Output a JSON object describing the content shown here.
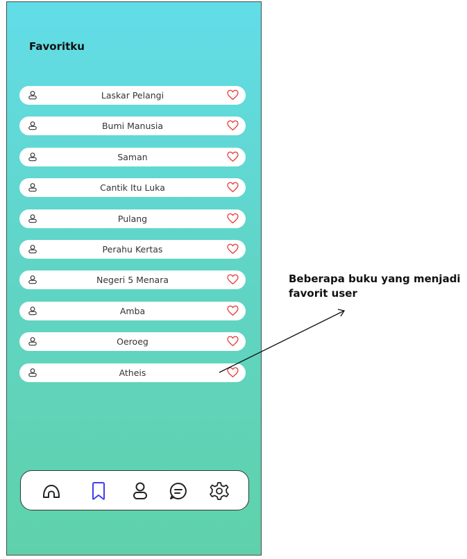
{
  "page": {
    "title": "Favoritku"
  },
  "favorites": [
    {
      "title": "Laskar Pelangi"
    },
    {
      "title": "Bumi Manusia"
    },
    {
      "title": "Saman"
    },
    {
      "title": "Cantik Itu Luka"
    },
    {
      "title": "Pulang"
    },
    {
      "title": "Perahu Kertas"
    },
    {
      "title": "Negeri 5 Menara"
    },
    {
      "title": "Amba"
    },
    {
      "title": "Oeroeg"
    },
    {
      "title": "Atheis"
    }
  ],
  "item_icons": {
    "left": "user-icon",
    "right": "heart-icon"
  },
  "nav": {
    "items": [
      {
        "icon": "home-icon",
        "active": false
      },
      {
        "icon": "bookmark-icon",
        "active": true
      },
      {
        "icon": "user-icon",
        "active": false
      },
      {
        "icon": "chat-icon",
        "active": false
      },
      {
        "icon": "settings-icon",
        "active": false
      }
    ]
  },
  "annotation": {
    "text": "Beberapa buku yang menjadi favorit user"
  },
  "colors": {
    "gradient_top": "#62dde8",
    "gradient_bottom": "#5fd1aa",
    "heart": "#e53935",
    "active_nav": "#3f3cf0",
    "icon": "#333333"
  }
}
